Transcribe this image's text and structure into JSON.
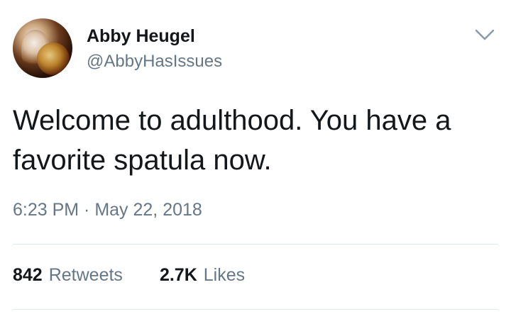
{
  "tweet": {
    "display_name": "Abby Heugel",
    "handle": "@AbbyHasIssues",
    "text": "Welcome to adulthood. You have a favorite spatula now.",
    "timestamp": "6:23 PM · May 22, 2018",
    "stats": {
      "retweets_count": "842",
      "retweets_label": "Retweets",
      "likes_count": "2.7K",
      "likes_label": "Likes"
    },
    "icons": {
      "menu": "chevron-down-icon"
    },
    "colors": {
      "primary_text": "#14171a",
      "secondary_text": "#657786",
      "divider": "#e1e8ed"
    }
  }
}
